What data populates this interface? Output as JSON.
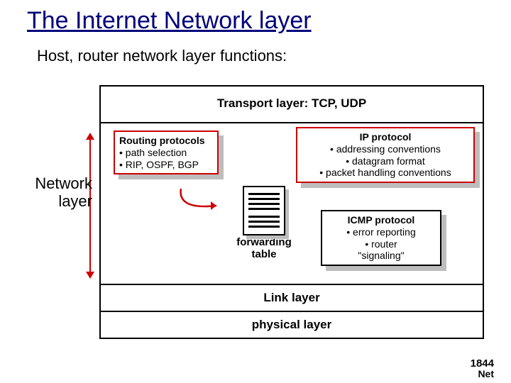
{
  "title": "The Internet Network layer",
  "subtitle": "Host, router network layer functions:",
  "side_label_l1": "Network",
  "side_label_l2": "layer",
  "layers": {
    "transport": "Transport layer: TCP, UDP",
    "link": "Link layer",
    "physical": "physical layer"
  },
  "routing": {
    "title": "Routing protocols",
    "b1": "• path selection",
    "b2": "• RIP, OSPF, BGP"
  },
  "ip": {
    "title": "IP protocol",
    "b1": "• addressing conventions",
    "b2": "• datagram format",
    "b3": "• packet handling conventions"
  },
  "icmp": {
    "title": "ICMP protocol",
    "b1": "• error reporting",
    "b2": "• router",
    "b3": "\"signaling\""
  },
  "fwd": {
    "l1": "forwarding",
    "l2": "table"
  },
  "footer": {
    "l1": "1844",
    "l2": "Net"
  }
}
